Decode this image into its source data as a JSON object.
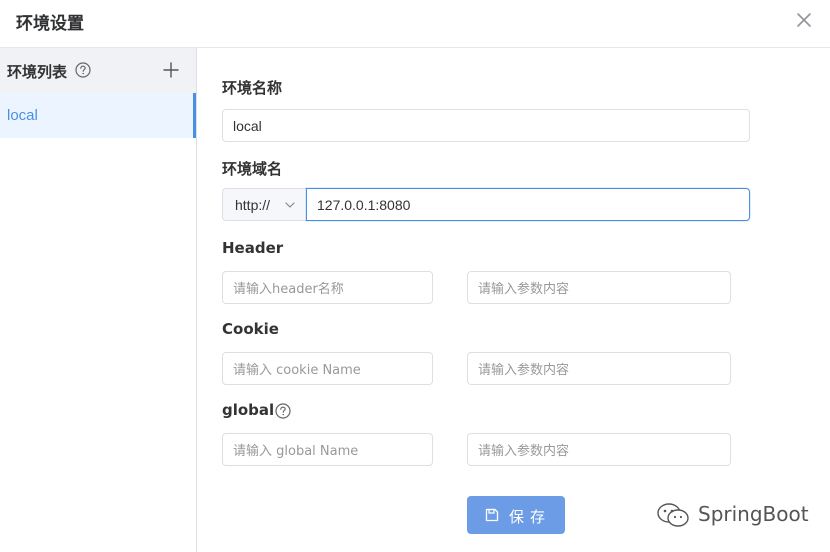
{
  "dialog": {
    "title": "环境设置"
  },
  "sidebar": {
    "title": "环境列表",
    "items": [
      {
        "label": "local"
      }
    ]
  },
  "form": {
    "env_name": {
      "label": "环境名称",
      "value": "local"
    },
    "env_domain": {
      "label": "环境域名",
      "protocol": "http://",
      "value": "127.0.0.1:8080"
    },
    "header": {
      "label": "Header",
      "name_placeholder": "请输入header名称",
      "value_placeholder": "请输入参数内容"
    },
    "cookie": {
      "label": "Cookie",
      "name_placeholder": "请输入 cookie Name",
      "value_placeholder": "请输入参数内容"
    },
    "global": {
      "label": "global",
      "name_placeholder": "请输入 global Name",
      "value_placeholder": "请输入参数内容"
    },
    "save_label": "保存"
  },
  "watermark": {
    "text": "SpringBoot"
  },
  "colors": {
    "accent": "#4a90e2",
    "save_button": "#6c9ce6",
    "sidebar_header_bg": "#f0f2f5",
    "active_item_bg": "#ecf5ff"
  },
  "icons": {
    "close": "close-icon",
    "help": "question-circle-icon",
    "add": "plus-icon",
    "chevron": "chevron-down-icon",
    "save": "save-icon",
    "watermark_logo": "wechat-icon"
  }
}
